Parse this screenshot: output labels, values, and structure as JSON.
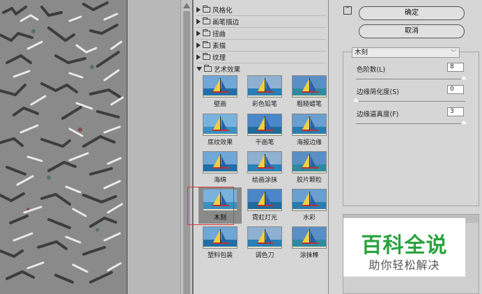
{
  "gallery": {
    "categories": [
      {
        "label": "风格化",
        "expanded": false
      },
      {
        "label": "画笔描边",
        "expanded": false
      },
      {
        "label": "扭曲",
        "expanded": false
      },
      {
        "label": "素描",
        "expanded": false
      },
      {
        "label": "纹理",
        "expanded": false
      },
      {
        "label": "艺术效果",
        "expanded": true
      }
    ],
    "filters": [
      {
        "label": "壁画"
      },
      {
        "label": "彩色铅笔"
      },
      {
        "label": "粗糙蜡笔"
      },
      {
        "label": "底纹效果"
      },
      {
        "label": "干画笔"
      },
      {
        "label": "海报边缘"
      },
      {
        "label": "海绵"
      },
      {
        "label": "绘画涂抹"
      },
      {
        "label": "胶片颗粒"
      },
      {
        "label": "木刻",
        "selected": true
      },
      {
        "label": "霓虹灯光"
      },
      {
        "label": "水彩"
      },
      {
        "label": "塑料包装"
      },
      {
        "label": "调色刀"
      },
      {
        "label": "涂抹棒"
      }
    ]
  },
  "settings": {
    "ok_label": "确定",
    "cancel_label": "取消",
    "collapse_icon": "collapse-up-icon",
    "filter_name": "木刻",
    "params": [
      {
        "label": "色阶数(L)",
        "value": "8",
        "level": 1.0
      },
      {
        "label": "边缘简化度(S)",
        "value": "0",
        "level": 0.0
      },
      {
        "label": "边缘逼真度(F)",
        "value": "3",
        "level": 1.0
      }
    ]
  },
  "watermark": {
    "title": "百科全说",
    "subtitle": "助你轻松解决"
  },
  "colors": {
    "accent_selected": "#d23a3a",
    "watermark_green": "#2aa33d"
  }
}
